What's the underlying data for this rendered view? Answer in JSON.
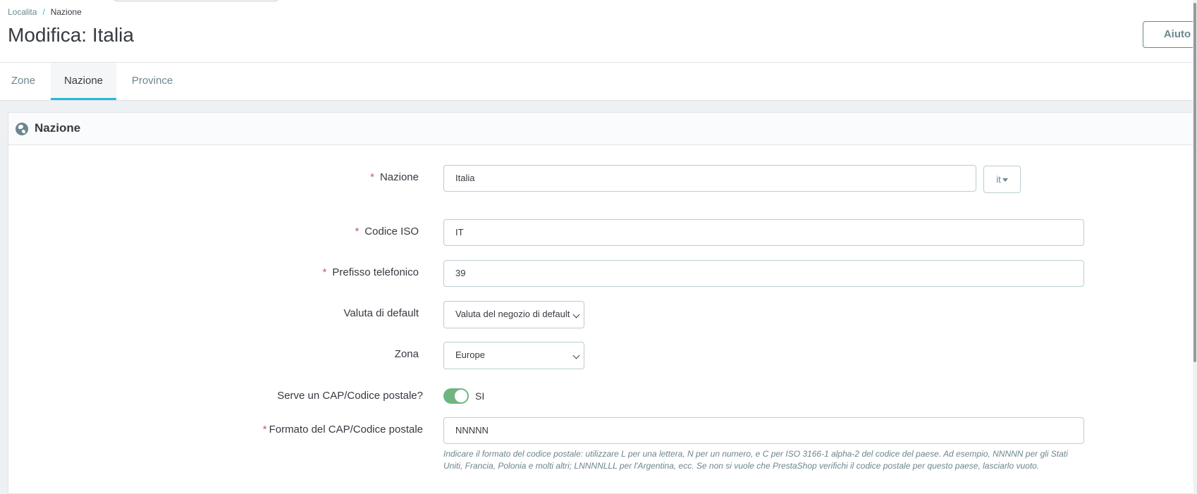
{
  "breadcrumb": {
    "parent": "Localita",
    "separator": "/",
    "current": "Nazione"
  },
  "page_title": "Modifica: Italia",
  "help_button": "Aiuto",
  "tabs": [
    {
      "label": "Zone",
      "active": false
    },
    {
      "label": "Nazione",
      "active": true
    },
    {
      "label": "Province",
      "active": false
    }
  ],
  "panel": {
    "title": "Nazione",
    "icon": "globe-icon"
  },
  "form": {
    "required_mark": "*",
    "country_name": {
      "label": "Nazione",
      "value": "Italia",
      "lang": "it"
    },
    "iso_code": {
      "label": "Codice ISO",
      "value": "IT"
    },
    "phone_prefix": {
      "label": "Prefisso telefonico",
      "value": "39"
    },
    "default_currency": {
      "label": "Valuta di default",
      "value": "Valuta del negozio di default"
    },
    "zone": {
      "label": "Zona",
      "value": "Europe"
    },
    "need_zip": {
      "label": "Serve un CAP/Codice postale?",
      "value": "SI",
      "enabled": true
    },
    "zip_format": {
      "label": "Formato del CAP/Codice postale",
      "value": "NNNNN",
      "help": "Indicare il formato del codice postale: utilizzare L per una lettera, N per un numero, e C per ISO 3166-1 alpha-2 del codice del paese. Ad esempio, NNNNN per gli Stati Uniti, Francia, Polonia e molti altri; LNNNNLLL per l'Argentina, ecc. Se non si vuole che PrestaShop verifichi il codice postale per questo paese, lasciarlo vuoto."
    }
  },
  "colors": {
    "accent": "#25b9d7",
    "toggle_on": "#70b580",
    "required": "#c05c67"
  }
}
